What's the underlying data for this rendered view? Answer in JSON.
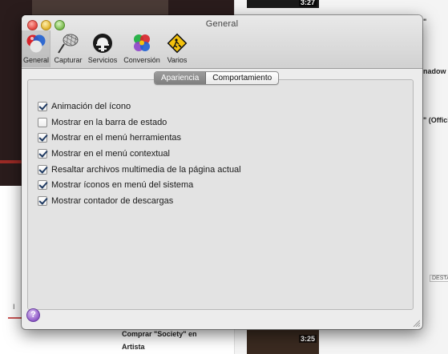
{
  "window": {
    "title": "General"
  },
  "toolbar": {
    "items": [
      {
        "label": "General",
        "icon": "color-balls-icon",
        "selected": true
      },
      {
        "label": "Capturar",
        "icon": "net-icon",
        "selected": false
      },
      {
        "label": "Servicios",
        "icon": "helmet-icon",
        "selected": false
      },
      {
        "label": "Conversión",
        "icon": "converter-balls-icon",
        "selected": false
      },
      {
        "label": "Varios",
        "icon": "warning-sign-icon",
        "selected": false
      }
    ]
  },
  "tabs": {
    "active": "Apariencia",
    "items": [
      "Apariencia",
      "Comportamiento"
    ]
  },
  "options": [
    {
      "label": "Animación del ícono",
      "checked": true
    },
    {
      "label": "Mostrar en la barra de estado",
      "checked": false
    },
    {
      "label": "Mostrar en el menú herramientas",
      "checked": true
    },
    {
      "label": "Mostrar en el menú contextual",
      "checked": true
    },
    {
      "label": "Resaltar archivos multimedia de la página actual",
      "checked": true
    },
    {
      "label": "Mostrar íconos en menú del sistema",
      "checked": true
    },
    {
      "label": "Mostrar contador de descargas",
      "checked": true
    }
  ],
  "help": {
    "label": "?"
  },
  "background": {
    "durations": [
      "3:27",
      "3:25"
    ],
    "snippets": [
      "\"",
      "nadow I",
      "\" (Offici",
      "Comprar \"Society\" en",
      "Artista"
    ],
    "badge": "DESTA",
    "left_snippet": "I"
  },
  "colors": {
    "window_bg": "#ececec",
    "checkbox_mark": "#1f3a62",
    "active_tab": "#8c8c8c"
  }
}
